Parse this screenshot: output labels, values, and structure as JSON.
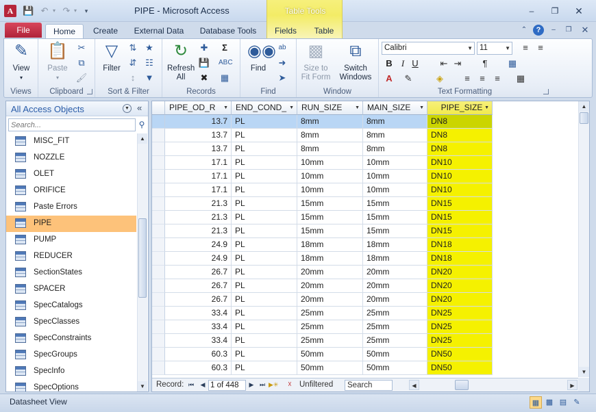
{
  "titlebar": {
    "app_icon": "A",
    "title": "PIPE  -  Microsoft Access",
    "contextual_group": "Table Tools"
  },
  "tabs": {
    "file": "File",
    "home": "Home",
    "create": "Create",
    "external": "External Data",
    "dbtools": "Database Tools",
    "fields": "Fields",
    "table": "Table"
  },
  "ribbon": {
    "views": {
      "label": "Views",
      "view_btn": "View"
    },
    "clipboard": {
      "label": "Clipboard",
      "paste_btn": "Paste"
    },
    "sort_filter": {
      "label": "Sort & Filter",
      "filter_btn": "Filter"
    },
    "records": {
      "label": "Records",
      "refresh_btn": "Refresh All"
    },
    "find": {
      "label": "Find",
      "find_btn": "Find"
    },
    "window": {
      "label": "Window",
      "size_btn": "Size to Fit Form",
      "switch_btn": "Switch Windows"
    },
    "text_formatting": {
      "label": "Text Formatting",
      "font": "Calibri",
      "size": "11"
    }
  },
  "nav": {
    "title": "All Access Objects",
    "search_placeholder": "Search...",
    "items": [
      {
        "label": "MISC_FIT",
        "selected": false
      },
      {
        "label": "NOZZLE",
        "selected": false
      },
      {
        "label": "OLET",
        "selected": false
      },
      {
        "label": "ORIFICE",
        "selected": false
      },
      {
        "label": "Paste Errors",
        "selected": false
      },
      {
        "label": "PIPE",
        "selected": true
      },
      {
        "label": "PUMP",
        "selected": false
      },
      {
        "label": "REDUCER",
        "selected": false
      },
      {
        "label": "SectionStates",
        "selected": false
      },
      {
        "label": "SPACER",
        "selected": false
      },
      {
        "label": "SpecCatalogs",
        "selected": false
      },
      {
        "label": "SpecClasses",
        "selected": false
      },
      {
        "label": "SpecConstraints",
        "selected": false
      },
      {
        "label": "SpecGroups",
        "selected": false
      },
      {
        "label": "SpecInfo",
        "selected": false
      },
      {
        "label": "SpecOptions",
        "selected": false
      }
    ]
  },
  "table": {
    "columns": [
      "PIPE_OD_R",
      "END_COND_",
      "RUN_SIZE",
      "MAIN_SIZE",
      "PIPE_SIZE"
    ],
    "selected_column": "PIPE_SIZE",
    "rows": [
      [
        "13.7",
        "PL",
        "8mm",
        "8mm",
        "DN8"
      ],
      [
        "13.7",
        "PL",
        "8mm",
        "8mm",
        "DN8"
      ],
      [
        "13.7",
        "PL",
        "8mm",
        "8mm",
        "DN8"
      ],
      [
        "17.1",
        "PL",
        "10mm",
        "10mm",
        "DN10"
      ],
      [
        "17.1",
        "PL",
        "10mm",
        "10mm",
        "DN10"
      ],
      [
        "17.1",
        "PL",
        "10mm",
        "10mm",
        "DN10"
      ],
      [
        "21.3",
        "PL",
        "15mm",
        "15mm",
        "DN15"
      ],
      [
        "21.3",
        "PL",
        "15mm",
        "15mm",
        "DN15"
      ],
      [
        "21.3",
        "PL",
        "15mm",
        "15mm",
        "DN15"
      ],
      [
        "24.9",
        "PL",
        "18mm",
        "18mm",
        "DN18"
      ],
      [
        "24.9",
        "PL",
        "18mm",
        "18mm",
        "DN18"
      ],
      [
        "26.7",
        "PL",
        "20mm",
        "20mm",
        "DN20"
      ],
      [
        "26.7",
        "PL",
        "20mm",
        "20mm",
        "DN20"
      ],
      [
        "26.7",
        "PL",
        "20mm",
        "20mm",
        "DN20"
      ],
      [
        "33.4",
        "PL",
        "25mm",
        "25mm",
        "DN25"
      ],
      [
        "33.4",
        "PL",
        "25mm",
        "25mm",
        "DN25"
      ],
      [
        "33.4",
        "PL",
        "25mm",
        "25mm",
        "DN25"
      ],
      [
        "60.3",
        "PL",
        "50mm",
        "50mm",
        "DN50"
      ],
      [
        "60.3",
        "PL",
        "50mm",
        "50mm",
        "DN50"
      ]
    ]
  },
  "recordbar": {
    "label": "Record:",
    "current": "1 of 448",
    "filter_status": "Unfiltered",
    "search": "Search"
  },
  "status": {
    "text": "Datasheet View"
  },
  "colors": {
    "selected_column": "#f5f100",
    "current_row": "#b9d6f5",
    "nav_selected": "#fdc27a",
    "file_tab": "#c0324a"
  }
}
